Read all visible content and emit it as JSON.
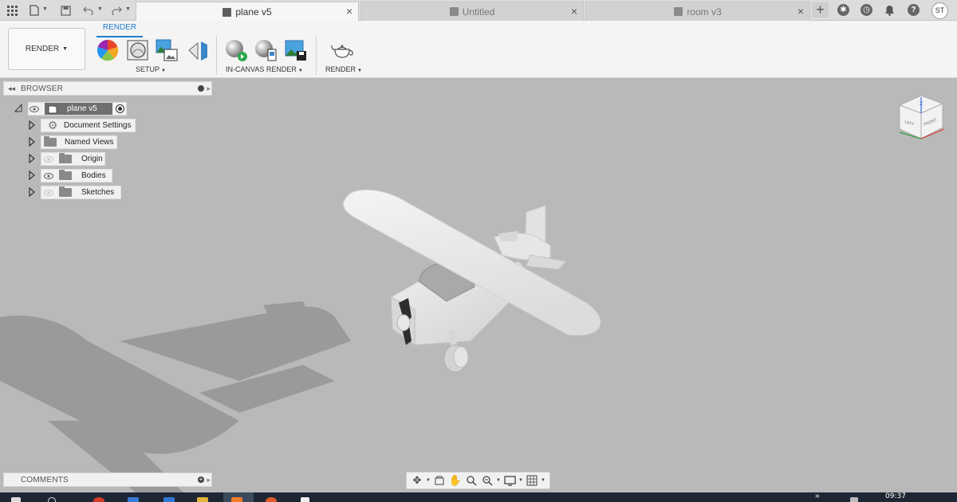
{
  "tabs": [
    {
      "label": "plane v5",
      "active": true
    },
    {
      "label": "Untitled",
      "active": false
    },
    {
      "label": "room v3",
      "active": false
    }
  ],
  "user": {
    "initials": "ST"
  },
  "ribbon": {
    "workspace_label": "RENDER",
    "active_tab": "RENDER",
    "groups": {
      "setup": "SETUP",
      "in_canvas": "IN-CANVAS RENDER",
      "render": "RENDER"
    }
  },
  "browser": {
    "title": "BROWSER",
    "root": "plane v5",
    "items": [
      {
        "label": "Document Settings",
        "icon": "gear-icon"
      },
      {
        "label": "Named Views",
        "icon": "folder-icon"
      },
      {
        "label": "Origin",
        "icon": "folder-icon"
      },
      {
        "label": "Bodies",
        "icon": "folder-icon"
      },
      {
        "label": "Sketches",
        "icon": "folder-icon"
      }
    ]
  },
  "viewcube": {
    "left": "LEFT",
    "front": "FRONT",
    "axis": "Z"
  },
  "comments": {
    "title": "COMMENTS"
  },
  "taskbar": {
    "time": "09:37",
    "overflow": "»"
  },
  "colors": {
    "accent": "#1f7ccc",
    "viewport_bg": "#b9b9b9"
  }
}
